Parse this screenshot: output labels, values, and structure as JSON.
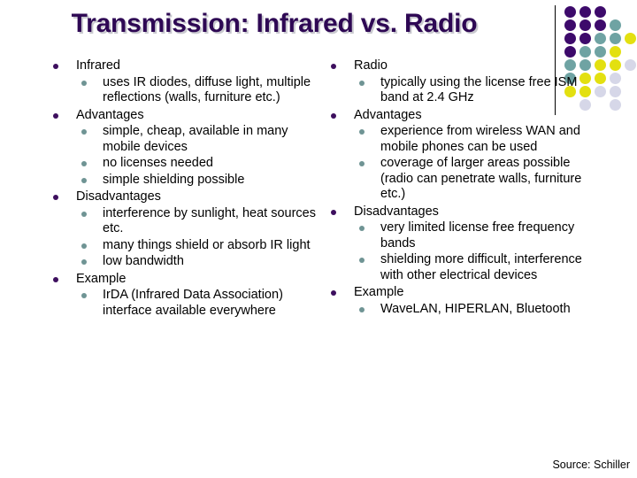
{
  "slide": {
    "title": "Transmission: Infrared vs. Radio",
    "source": "Source: Schiller",
    "title_color": "#2E0854",
    "title_shadow_color": "#C9C9CF",
    "bullet1_color": "#3D0F5E",
    "bullet2_color": "#6F9494",
    "background": "#FFFFFF"
  },
  "decoration": {
    "name": "dot-grid",
    "divider": true,
    "colors": {
      "purple": "#3D0A6B",
      "teal": "#6FA3A3",
      "yellow": "#E3E010",
      "lavender": "#D6D7E8"
    },
    "rows": [
      [
        "purple",
        "purple",
        "purple",
        null,
        null
      ],
      [
        "purple",
        "purple",
        "purple",
        "teal",
        null
      ],
      [
        "purple",
        "purple",
        "teal",
        "teal",
        "yellow"
      ],
      [
        "purple",
        "teal",
        "teal",
        "yellow",
        null
      ],
      [
        "teal",
        "teal",
        "yellow",
        "yellow",
        "lavender"
      ],
      [
        "teal",
        "yellow",
        "yellow",
        "lavender",
        null
      ],
      [
        "yellow",
        "yellow",
        "lavender",
        "lavender",
        null
      ],
      [
        null,
        "lavender",
        null,
        "lavender",
        null
      ]
    ]
  },
  "left_column": {
    "heading": "Infrared",
    "groups": [
      {
        "label": "Infrared",
        "children": [
          "uses IR diodes, diffuse light, multiple reflections (walls, furniture etc.)"
        ]
      },
      {
        "label": "Advantages",
        "children": [
          "simple, cheap, available in many mobile devices",
          "no licenses needed",
          "simple shielding possible"
        ]
      },
      {
        "label": "Disadvantages",
        "children": [
          "interference by sunlight, heat sources etc.",
          "many things shield or absorb IR light",
          "low bandwidth"
        ]
      },
      {
        "label": "Example",
        "children": [
          "IrDA (Infrared Data Association) interface available everywhere"
        ]
      }
    ]
  },
  "right_column": {
    "heading": "Radio",
    "groups": [
      {
        "label": "Radio",
        "children": [
          "typically using the license free ISM band at 2.4 GHz"
        ]
      },
      {
        "label": "Advantages",
        "children": [
          "experience from wireless WAN and mobile phones can be used",
          "coverage of larger areas possible (radio can penetrate walls, furniture etc.)"
        ]
      },
      {
        "label": "Disadvantages",
        "children": [
          "very limited license free frequency bands",
          "shielding more difficult, interference with other electrical devices"
        ]
      },
      {
        "label": "Example",
        "children": [
          "WaveLAN, HIPERLAN, Bluetooth"
        ]
      }
    ]
  }
}
